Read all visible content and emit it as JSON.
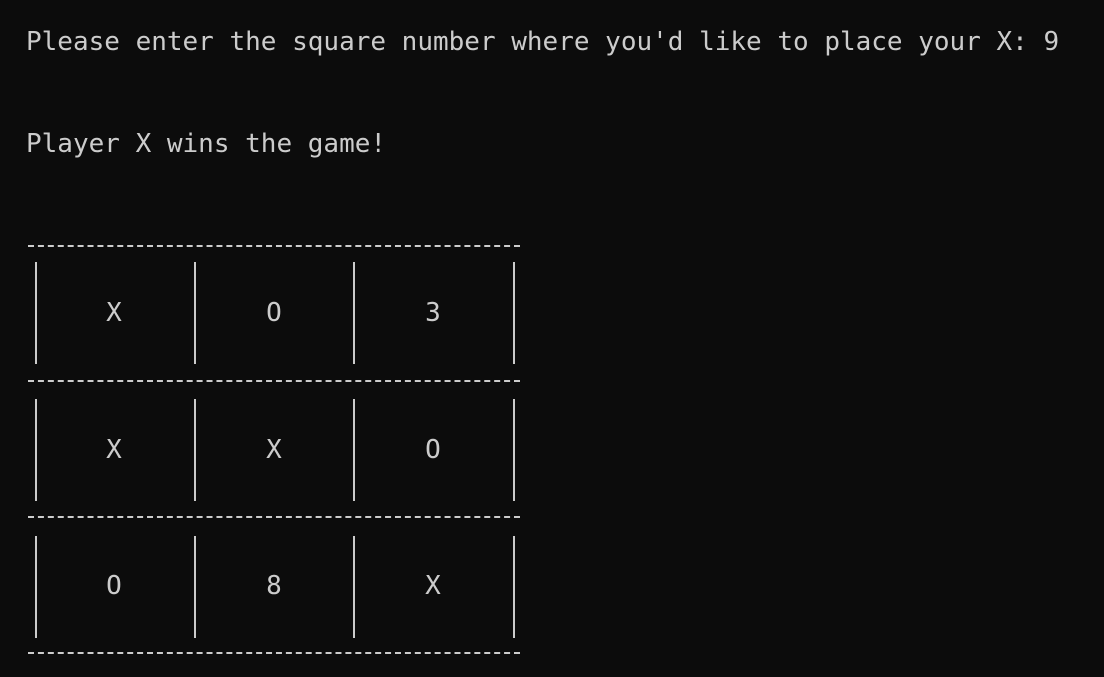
{
  "console": {
    "prompt_text": "Please enter the square number where you'd like to place your X: 9",
    "result_text": "Player X wins the game!"
  },
  "board": {
    "cells": [
      "X",
      "O",
      "3",
      "X",
      "X",
      "O",
      "O",
      "8",
      "X"
    ]
  }
}
